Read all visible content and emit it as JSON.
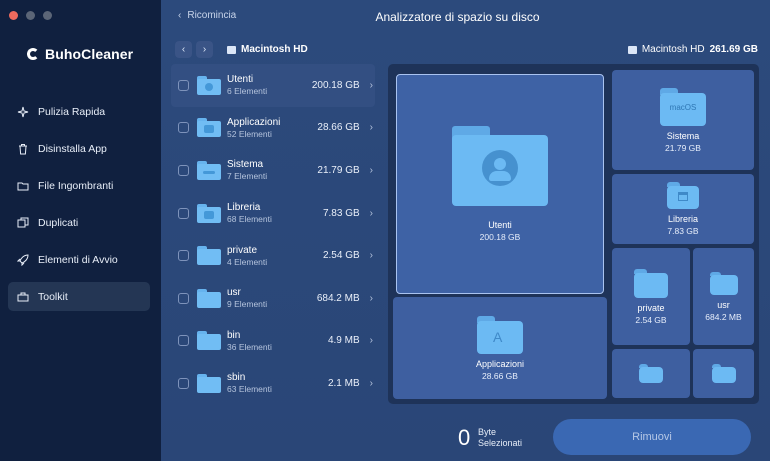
{
  "app": {
    "brand": "BuhoCleaner"
  },
  "sidebar": {
    "items": [
      {
        "label": "Pulizia Rapida",
        "icon": "sparkle-icon"
      },
      {
        "label": "Disinstalla App",
        "icon": "trash-icon"
      },
      {
        "label": "File Ingombranti",
        "icon": "folder-icon"
      },
      {
        "label": "Duplicati",
        "icon": "duplicate-icon"
      },
      {
        "label": "Elementi di Avvio",
        "icon": "rocket-icon"
      },
      {
        "label": "Toolkit",
        "icon": "toolkit-icon"
      }
    ],
    "active": "Toolkit"
  },
  "header": {
    "back_label": "Ricomincia",
    "title": "Analizzatore di spazio su disco"
  },
  "path": {
    "current": "Macintosh HD"
  },
  "disk": {
    "name": "Macintosh HD",
    "size": "261.69 GB"
  },
  "list": [
    {
      "name": "Utenti",
      "count": "6 Elementi",
      "size": "200.18 GB"
    },
    {
      "name": "Applicazioni",
      "count": "52 Elementi",
      "size": "28.66 GB"
    },
    {
      "name": "Sistema",
      "count": "7 Elementi",
      "size": "21.79 GB"
    },
    {
      "name": "Libreria",
      "count": "68 Elementi",
      "size": "7.83 GB"
    },
    {
      "name": "private",
      "count": "4 Elementi",
      "size": "2.54 GB"
    },
    {
      "name": "usr",
      "count": "9 Elementi",
      "size": "684.2 MB"
    },
    {
      "name": "bin",
      "count": "36 Elementi",
      "size": "4.9 MB"
    },
    {
      "name": "sbin",
      "count": "63 Elementi",
      "size": "2.1 MB"
    }
  ],
  "treemap": {
    "utenti": {
      "name": "Utenti",
      "size": "200.18 GB"
    },
    "applicazioni": {
      "name": "Applicazioni",
      "size": "28.66 GB"
    },
    "sistema": {
      "name": "Sistema",
      "size": "21.79 GB",
      "badge": "macOS"
    },
    "libreria": {
      "name": "Libreria",
      "size": "7.83 GB"
    },
    "private": {
      "name": "private",
      "size": "2.54 GB"
    },
    "usr": {
      "name": "usr",
      "size": "684.2 MB"
    }
  },
  "footer": {
    "selected_count": "0",
    "selected_label_1": "Byte",
    "selected_label_2": "Selezionati",
    "remove_label": "Rimuovi"
  },
  "colors": {
    "sidebar": "#10203f",
    "main": "#2b4574",
    "folder": "#71bdf4",
    "accent": "#3a68b3"
  }
}
